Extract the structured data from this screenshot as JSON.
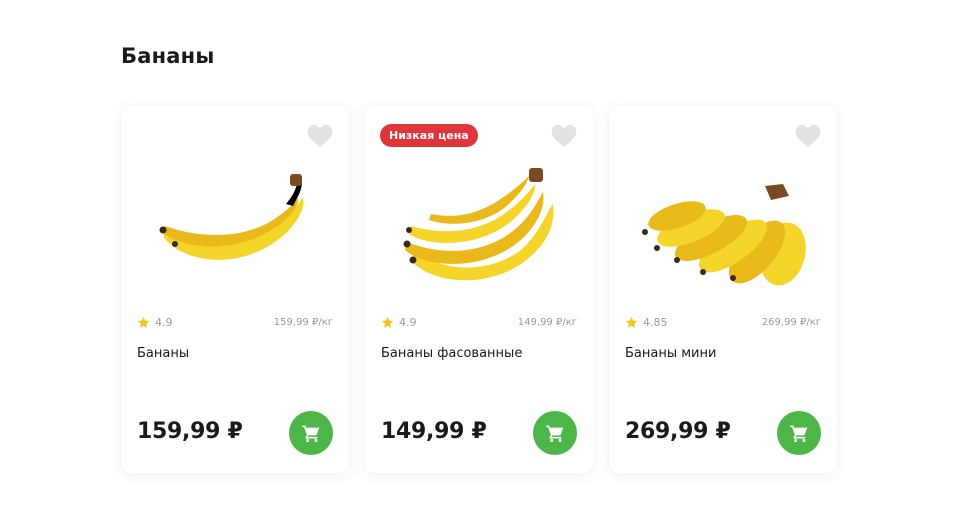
{
  "page": {
    "title": "Бананы"
  },
  "colors": {
    "badge_red": "#e0353b",
    "cart_green": "#4cb748",
    "star_yellow": "#f5c11b",
    "heart_gray": "#e2e2e2",
    "banana_yellow": "#f6d52a",
    "banana_shade": "#e9b81a"
  },
  "products": [
    {
      "badge": "",
      "rating": "4.9",
      "unit_price": "159,99 ₽/кг",
      "name": "Бананы",
      "price": "159,99 ₽",
      "image": "banana-single-image"
    },
    {
      "badge": "Низкая цена",
      "rating": "4.9",
      "unit_price": "149,99 ₽/кг",
      "name": "Бананы фасованные",
      "price": "149,99 ₽",
      "image": "banana-bunch-image"
    },
    {
      "badge": "",
      "rating": "4.85",
      "unit_price": "269,99 ₽/кг",
      "name": "Бананы мини",
      "price": "269,99 ₽",
      "image": "mini-banana-bunch-image"
    }
  ],
  "icons": {
    "favorite": "heart-icon",
    "rating": "star-icon",
    "cart": "cart-icon"
  }
}
